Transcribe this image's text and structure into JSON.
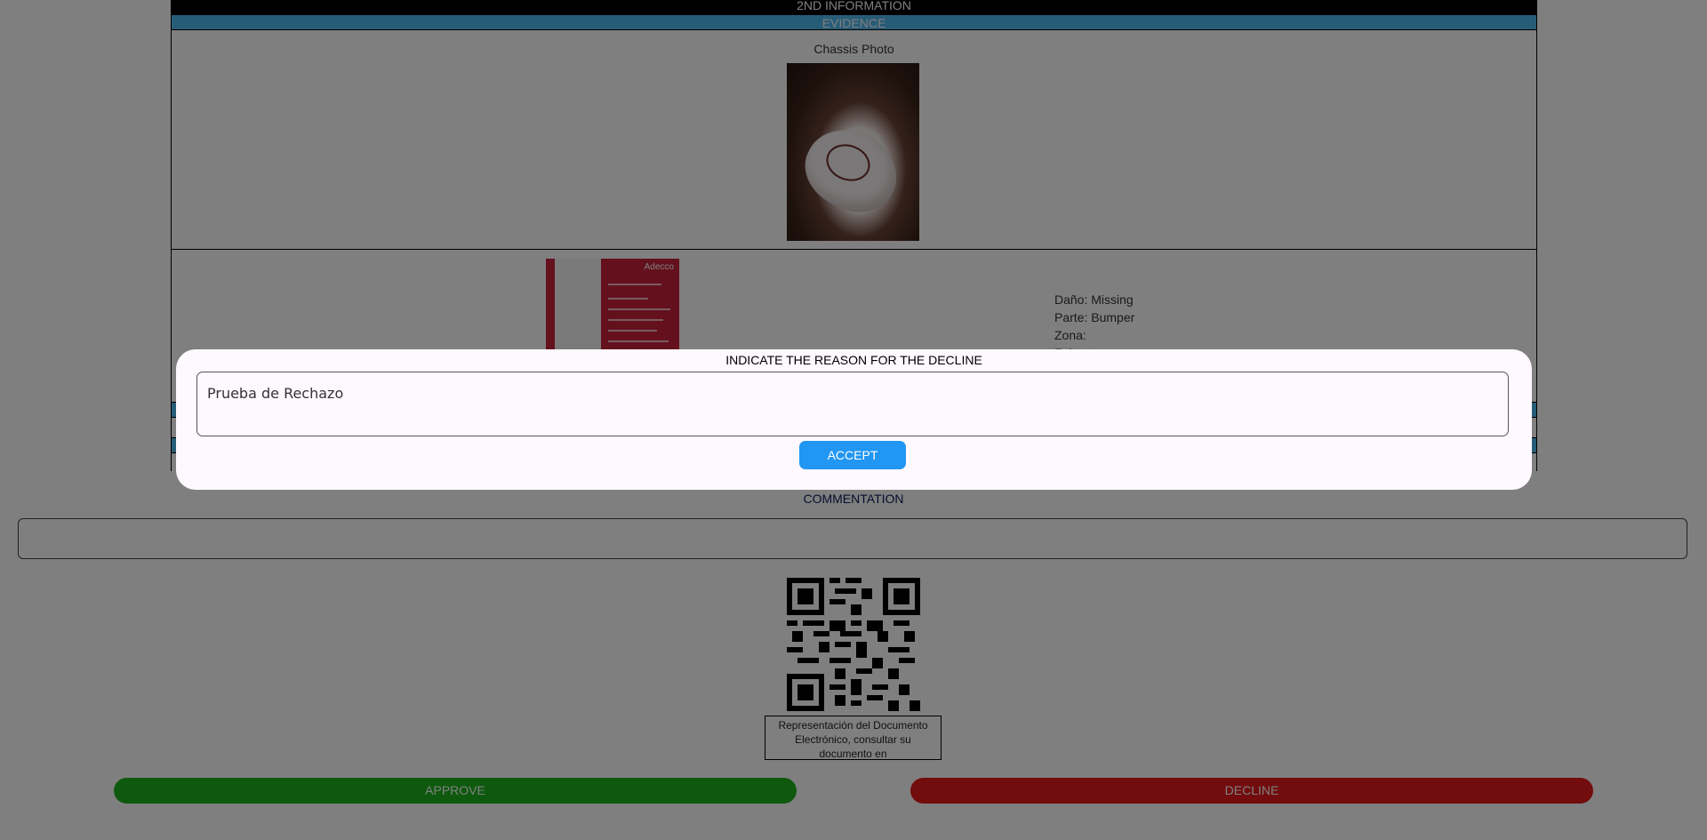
{
  "report": {
    "header_dark": "2ND INFORMATION",
    "header_blue": "EVIDENCE",
    "chassis_label": "Chassis Photo",
    "damage": {
      "thumb_brand": "Adecco",
      "dano": "Daño: Missing",
      "parte": "Parte: Bumper",
      "zona": "Zona:",
      "extra": "Faltantes:"
    }
  },
  "comment": {
    "label": "COMMENTATION",
    "value": ""
  },
  "qr": {
    "caption": "Representación del Documento Electrónico, consultar su documento en"
  },
  "actions": {
    "approve": "APPROVE",
    "decline": "DECLINE"
  },
  "dialog": {
    "title": "INDICATE THE REASON FOR THE DECLINE",
    "reason_value": "Prueba de Rechazo",
    "accept": "ACCEPT"
  },
  "colors": {
    "blue_bar": "#4fb9ee",
    "approve": "#1db31d",
    "decline": "#e5191b",
    "accept": "#2196f3"
  }
}
